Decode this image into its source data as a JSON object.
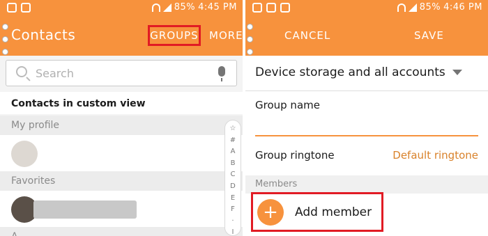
{
  "left": {
    "status": {
      "battery": "85%",
      "time": "4:45 PM"
    },
    "appbar": {
      "title": "Contacts",
      "groups": "GROUPS",
      "more": "MORE"
    },
    "search": {
      "placeholder": "Search"
    },
    "custom_view": "Contacts in custom view",
    "my_profile": "My profile",
    "favorites": "Favorites",
    "index_letter": "A",
    "index": [
      "☆",
      "#",
      "A",
      "B",
      "C",
      "D",
      "E",
      "F",
      "·",
      "I"
    ]
  },
  "right": {
    "status": {
      "battery": "85%",
      "time": "4:46 PM"
    },
    "appbar": {
      "cancel": "CANCEL",
      "save": "SAVE"
    },
    "storage": "Device storage and all accounts",
    "group_name_label": "Group name",
    "ringtone_label": "Group ringtone",
    "ringtone_value": "Default ringtone",
    "members_header": "Members",
    "add_member": "Add member"
  },
  "colors": {
    "accent": "#f7923d",
    "highlight_box": "#e11b24",
    "ringtone_text": "#d9822b"
  },
  "icons": [
    "search-icon",
    "mic-icon",
    "plus-icon",
    "dropdown-caret-icon",
    "wifi-icon",
    "signal-icon"
  ]
}
